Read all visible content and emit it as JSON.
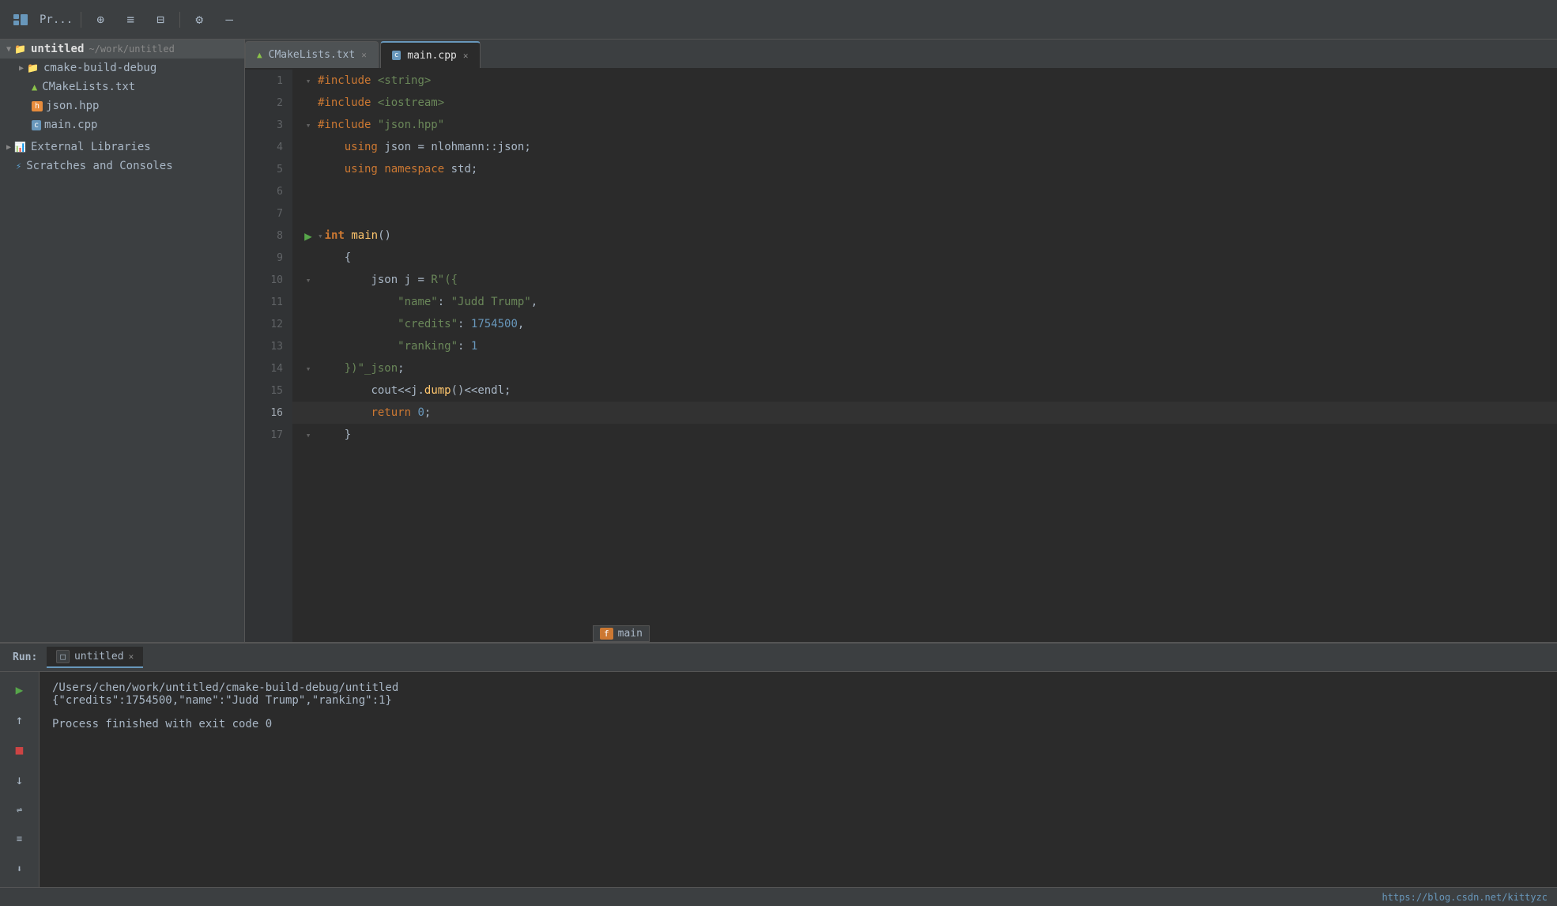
{
  "toolbar": {
    "project_label": "Pr...",
    "icons": [
      "grid-icon",
      "align-center-icon",
      "align-justify-icon",
      "gear-icon",
      "minus-icon"
    ]
  },
  "sidebar": {
    "items": [
      {
        "label": "untitled",
        "path": "~/work/untitled",
        "type": "folder",
        "expanded": true,
        "level": 0
      },
      {
        "label": "cmake-build-debug",
        "type": "folder",
        "expanded": false,
        "level": 1
      },
      {
        "label": "CMakeLists.txt",
        "type": "cmake",
        "level": 1
      },
      {
        "label": "json.hpp",
        "type": "json",
        "level": 1
      },
      {
        "label": "main.cpp",
        "type": "cpp",
        "level": 1
      },
      {
        "label": "External Libraries",
        "type": "extlib",
        "level": 0
      },
      {
        "label": "Scratches and Consoles",
        "type": "scratch",
        "level": 0
      }
    ]
  },
  "tabs": [
    {
      "label": "CMakeLists.txt",
      "type": "cmake",
      "active": false
    },
    {
      "label": "main.cpp",
      "type": "cpp",
      "active": true
    }
  ],
  "code_lines": [
    {
      "num": 1,
      "gutter": "fold",
      "content_html": "<span class='inc'>#include</span> <span class='hdr'>&lt;string&gt;</span>"
    },
    {
      "num": 2,
      "gutter": "",
      "content_html": "<span class='inc'>#include</span> <span class='hdr'>&lt;iostream&gt;</span>"
    },
    {
      "num": 3,
      "gutter": "fold",
      "content_html": "<span class='inc'>#include</span> <span class='hdr'>\"json.hpp\"</span>"
    },
    {
      "num": 4,
      "gutter": "",
      "content_html": "    <span class='kw'>using</span> <span class='plain'>json</span> <span class='plain'>=</span> <span class='plain'>nlohmann</span><span class='plain'>::</span><span class='plain'>json</span><span class='plain'>;</span>"
    },
    {
      "num": 5,
      "gutter": "",
      "content_html": "    <span class='kw'>using</span> <span class='kw'>namespace</span> <span class='plain'>std</span><span class='plain'>;</span>"
    },
    {
      "num": 6,
      "gutter": "",
      "content_html": ""
    },
    {
      "num": 7,
      "gutter": "",
      "content_html": ""
    },
    {
      "num": 8,
      "gutter": "run",
      "content_html": "<span class='plain'>    </span><span class='fold'>▾</span><span class='kw2'>int</span> <span class='fn'>main</span><span class='plain'>()</span>"
    },
    {
      "num": 9,
      "gutter": "",
      "content_html": "    <span class='plain'>{</span>"
    },
    {
      "num": 10,
      "gutter": "fold",
      "content_html": "        <span class='plain'>json</span> <span class='plain'>j</span> <span class='plain'>=</span> <span class='str'>R\"({</span>"
    },
    {
      "num": 11,
      "gutter": "",
      "content_html": "            <span class='key'>\"name\"</span><span class='plain'>:</span> <span class='str2'>\"Judd Trump\"</span><span class='plain'>,</span>"
    },
    {
      "num": 12,
      "gutter": "",
      "content_html": "            <span class='key'>\"credits\"</span><span class='plain'>:</span> <span class='num'>1754500</span><span class='plain'>,</span>"
    },
    {
      "num": 13,
      "gutter": "",
      "content_html": "            <span class='key'>\"ranking\"</span><span class='plain'>:</span> <span class='num'>1</span>"
    },
    {
      "num": 14,
      "gutter": "fold",
      "content_html": "    <span class='fold'>▾</span><span class='str'>})</span><span class='str2'>\"_json</span><span class='plain'>;</span>"
    },
    {
      "num": 15,
      "gutter": "",
      "content_html": "        <span class='plain'>cout</span><span class='plain'>&lt;&lt;</span><span class='plain'>j</span><span class='plain'>.</span><span class='fn'>dump</span><span class='plain'>()</span><span class='plain'>&lt;&lt;</span><span class='plain'>endl</span><span class='plain'>;</span>"
    },
    {
      "num": 16,
      "gutter": "",
      "content_html": "        <span class='kw'>return</span> <span class='num'>0</span><span class='plain'>;</span>"
    },
    {
      "num": 17,
      "gutter": "fold",
      "content_html": "    <span class='plain'>}</span>"
    }
  ],
  "tooltip": {
    "badge": "f",
    "label": "main"
  },
  "bottom_panel": {
    "run_label": "Run:",
    "tab_label": "untitled",
    "output_lines": [
      "/Users/chen/work/untitled/cmake-build-debug/untitled",
      "{\"credits\":1754500,\"name\":\"Judd Trump\",\"ranking\":1}",
      "",
      "Process finished with exit code 0"
    ]
  },
  "status_bar": {
    "url": "https://blog.csdn.net/kittyzc"
  }
}
